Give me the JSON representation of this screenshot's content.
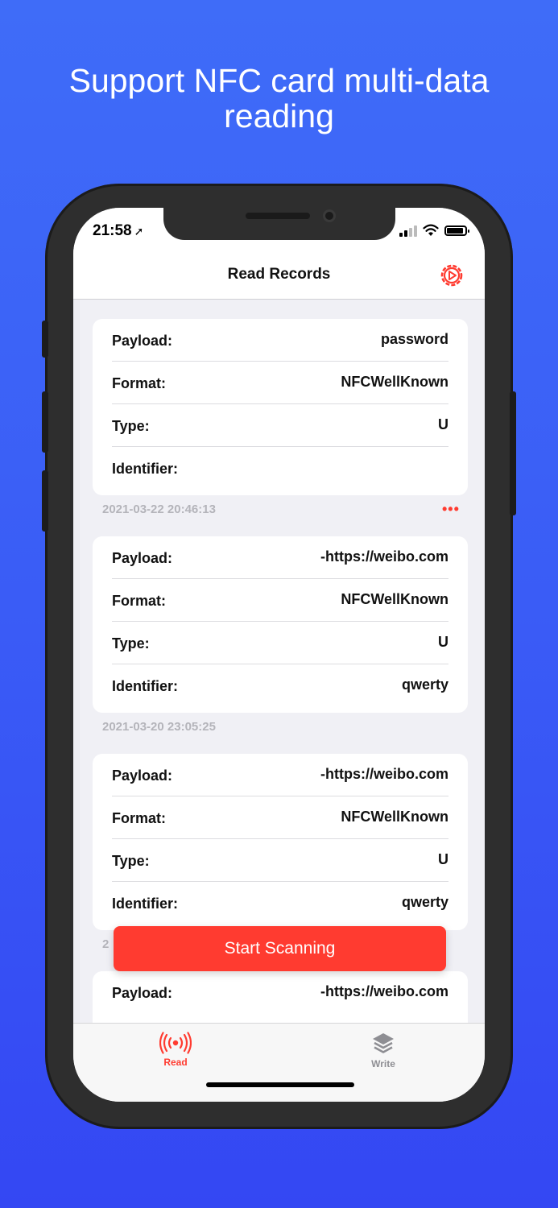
{
  "headline": {
    "line1": "Support NFC card multi-data",
    "line2": "reading"
  },
  "status_bar": {
    "time": "21:58",
    "location_icon": "location-arrow-icon"
  },
  "nav": {
    "title": "Read Records",
    "settings_icon": "gear-icon"
  },
  "records": [
    {
      "rows": [
        {
          "label": "Payload:",
          "value": "password"
        },
        {
          "label": "Format:",
          "value": "NFCWellKnown"
        },
        {
          "label": "Type:",
          "value": "U"
        },
        {
          "label": "Identifier:",
          "value": ""
        }
      ],
      "timestamp": "2021-03-22 20:46:13",
      "more": "•••"
    },
    {
      "rows": [
        {
          "label": "Payload:",
          "value": "-https://weibo.com"
        },
        {
          "label": "Format:",
          "value": "NFCWellKnown"
        },
        {
          "label": "Type:",
          "value": "U"
        },
        {
          "label": "Identifier:",
          "value": "qwerty"
        }
      ],
      "timestamp": "2021-03-20 23:05:25"
    },
    {
      "rows": [
        {
          "label": "Payload:",
          "value": "-https://weibo.com"
        },
        {
          "label": "Format:",
          "value": "NFCWellKnown"
        },
        {
          "label": "Type:",
          "value": "U"
        },
        {
          "label": "Identifier:",
          "value": "qwerty"
        }
      ],
      "timestamp": "2"
    },
    {
      "rows": [
        {
          "label": "Payload:",
          "value": "-https://weibo.com"
        }
      ]
    }
  ],
  "scan_button": {
    "label": "Start Scanning"
  },
  "tabs": [
    {
      "label": "Read",
      "icon": "nfc-wave-icon",
      "active": true,
      "color": "#ff3b30"
    },
    {
      "label": "Write",
      "icon": "layers-icon",
      "active": false,
      "color": "#8e8e93"
    }
  ],
  "colors": {
    "accent": "#ff3b30",
    "background_top": "#3f6cf8",
    "background_bottom": "#3447f3"
  }
}
